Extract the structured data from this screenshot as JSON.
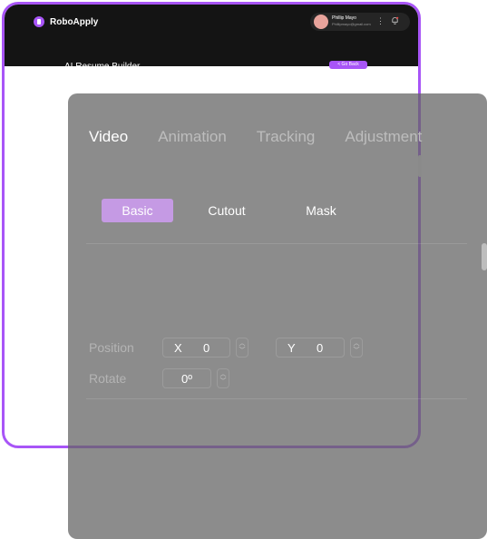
{
  "background_app": {
    "logo": "RoboApply",
    "user": {
      "name": "Phillip Mayo",
      "email": "Phillipmayo@gmail.com"
    },
    "page_title": "AI Resume Builder",
    "back_label": "< Go Back",
    "accent": "#a855f7"
  },
  "editor": {
    "tabs": [
      "Video",
      "Animation",
      "Tracking",
      "Adjustment"
    ],
    "active_tab": "Video",
    "subtabs": [
      "Basic",
      "Cutout",
      "Mask"
    ],
    "active_subtab": "Basic",
    "position": {
      "label": "Position",
      "x_label": "X",
      "x_value": "0",
      "y_label": "Y",
      "y_value": "0"
    },
    "rotate": {
      "label": "Rotate",
      "value": "0º"
    }
  }
}
